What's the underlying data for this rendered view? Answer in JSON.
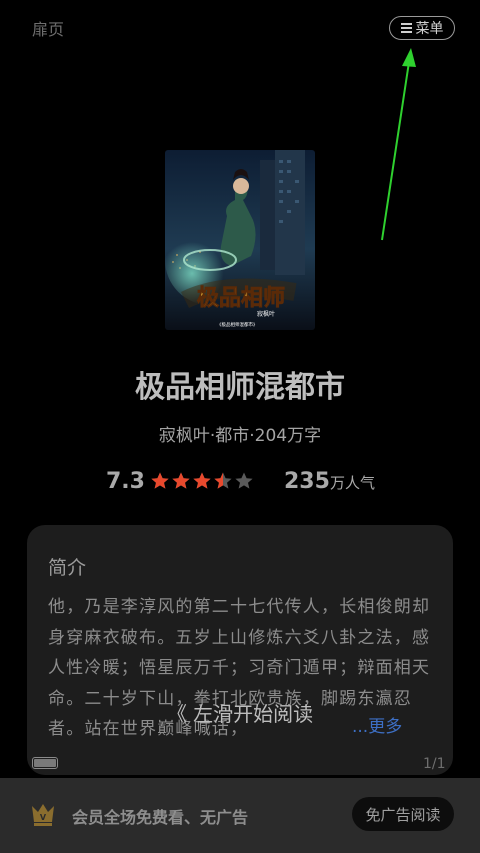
{
  "header": {
    "title": "扉页",
    "menu_label": "菜单"
  },
  "book": {
    "title": "极品相师混都市",
    "meta": "寂枫叶·都市·204万字",
    "score": "7.3",
    "rating_stars": 3.5,
    "rating_max": 5,
    "popularity_number": "235",
    "popularity_unit": "万人气",
    "cover": {
      "title_art": "极品相师",
      "author": "寂枫叶",
      "footer": "《极品相师混都市》"
    }
  },
  "intro": {
    "heading": "简介",
    "text": "他，乃是李淳风的第二十七代传人，长相俊朗却身穿麻衣破布。五岁上山修炼六爻八卦之法，感人性冷暖；悟星辰万千；习奇门遁甲；辩面相天命。二十岁下山，拳打北欧贵族，脚踢东瀛忍者。站在世界巅峰喊话，",
    "more_label": "...更多"
  },
  "swipe_hint": "《 左滑开始阅读",
  "status": {
    "page_indicator": "1/1",
    "battery_level": 1
  },
  "vip_bar": {
    "text": "会员全场免费看、无广告",
    "button_label": "免广告阅读"
  },
  "colors": {
    "star_active": "#e8492d",
    "star_inactive": "#5a5a5a",
    "more_link": "#3d6fc4",
    "annotation_arrow": "#2fd12f",
    "vip_icon": "#8a6d2e"
  }
}
